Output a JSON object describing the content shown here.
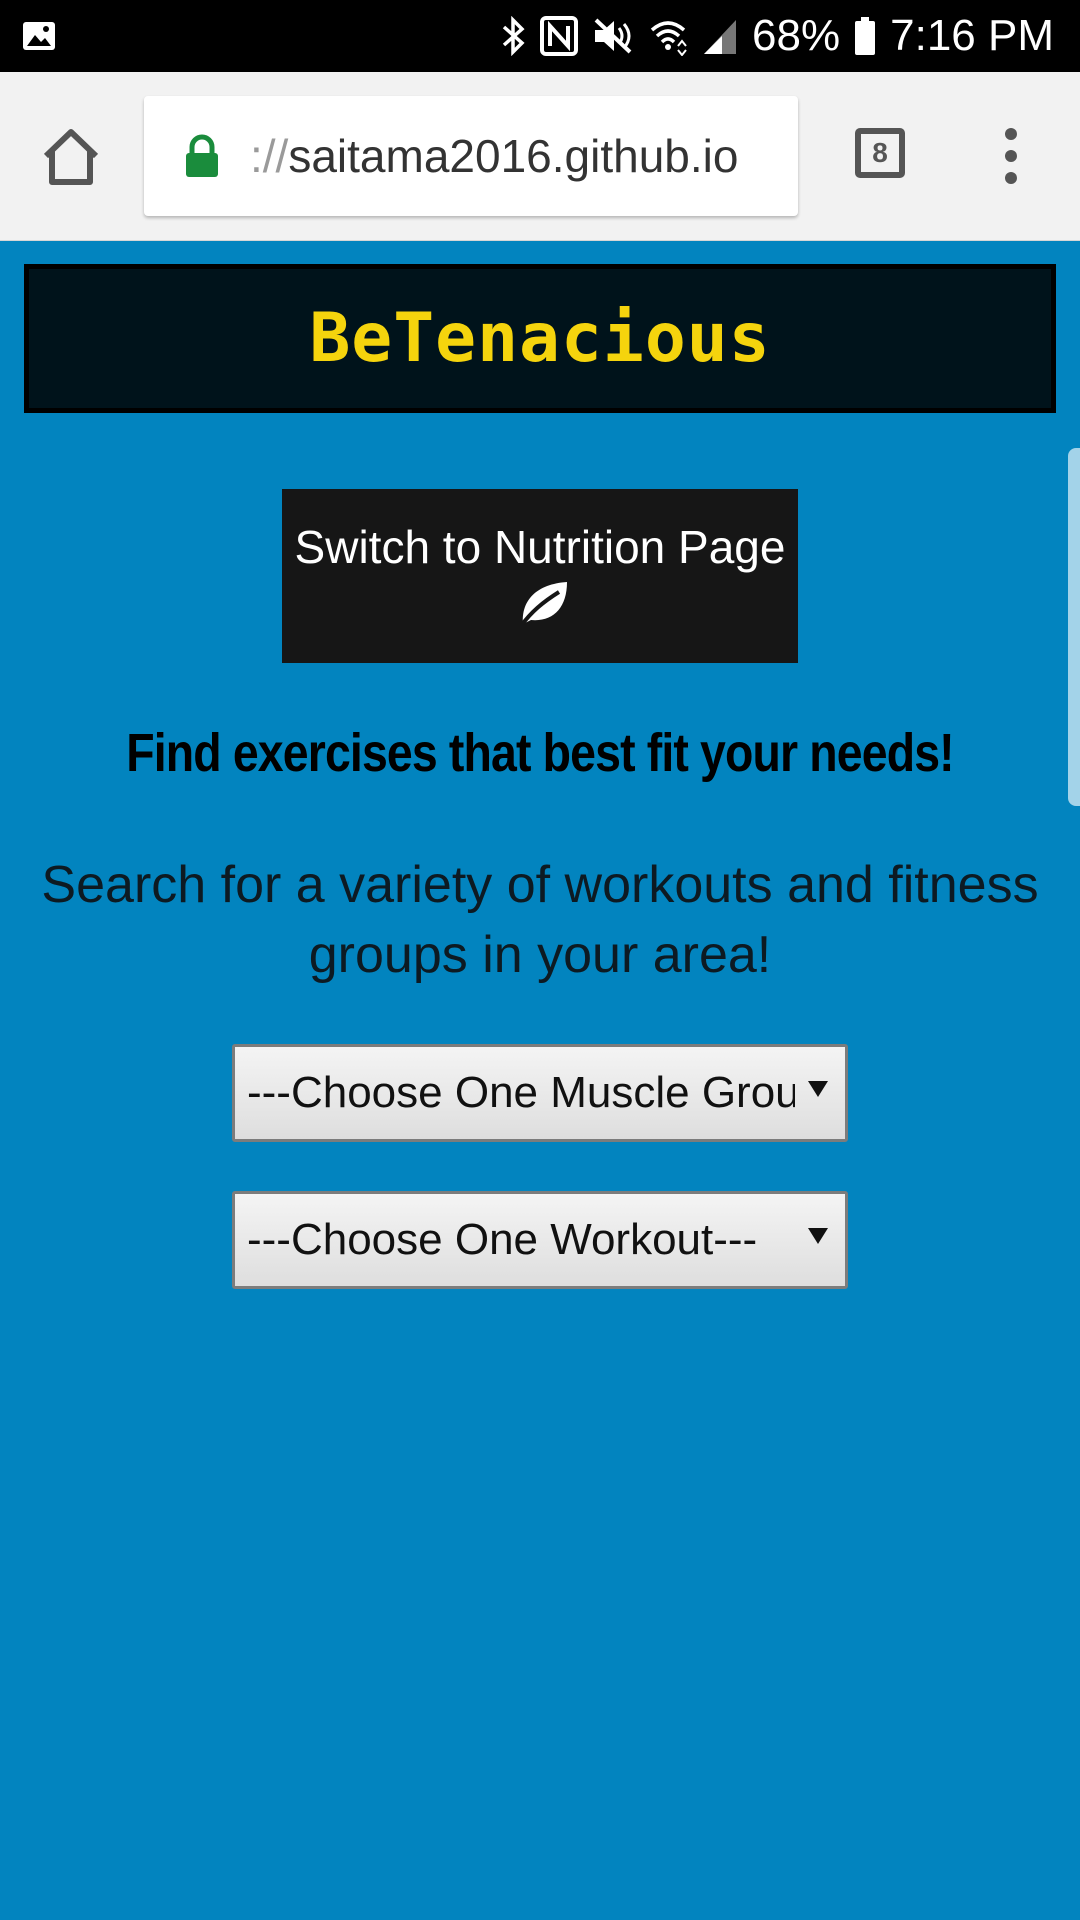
{
  "status_bar": {
    "battery": "68%",
    "time": "7:16 PM"
  },
  "browser": {
    "url_prefix": "://",
    "url_host": "saitama2016.github.io",
    "tab_count": "8"
  },
  "page": {
    "brand": "BeTenacious",
    "switch_button_label": "Switch to Nutrition Page",
    "headline": "Find exercises that best fit your needs!",
    "subtext": "Search for a variety of workouts and fitness groups in your area!",
    "muscle_select": "---Choose One Muscle Group---",
    "workout_select": "---Choose One Workout---"
  },
  "colors": {
    "page_background": "#0284bf",
    "banner_background": "#00131b",
    "brand_yellow": "#f5d40d",
    "button_background": "#161616",
    "lock_green": "#1a8c3c"
  },
  "icons": [
    "gallery-icon",
    "bluetooth-icon",
    "nfc-icon",
    "mute-icon",
    "wifi-icon",
    "signal-icon",
    "battery-icon",
    "home-icon",
    "lock-icon",
    "tabs-icon",
    "more-vert-icon",
    "leaf-icon",
    "dropdown-arrow-icon"
  ]
}
